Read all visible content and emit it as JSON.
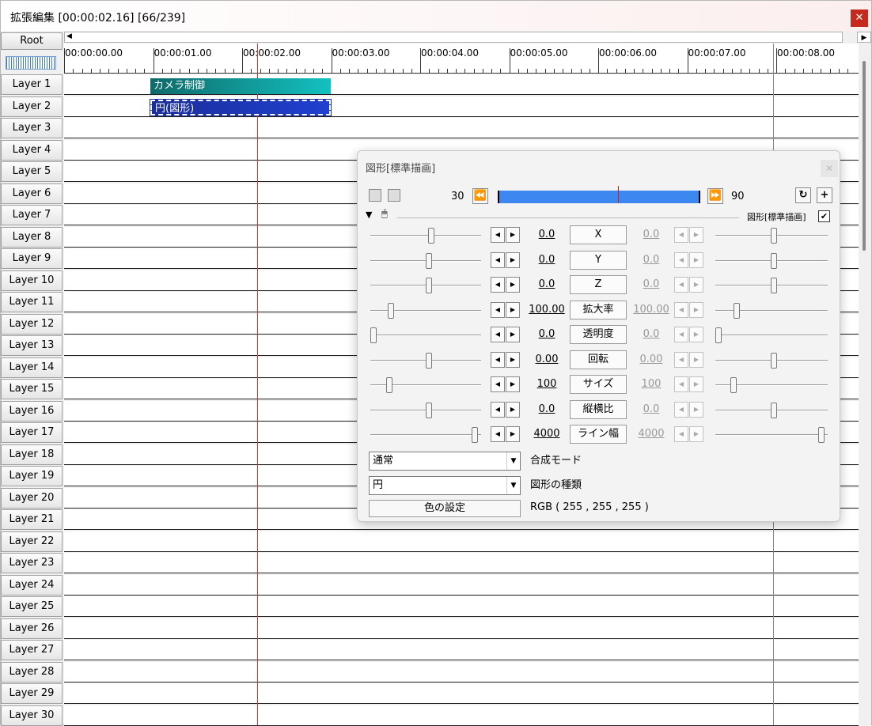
{
  "window": {
    "title": "拡張編集 [00:00:02.16] [66/239]",
    "close": "✕"
  },
  "timeline": {
    "root_label": "Root",
    "ruler": [
      "00:00:00.00",
      "00:00:01.00",
      "00:00:02.00",
      "00:00:03.00",
      "00:00:04.00",
      "00:00:05.00",
      "00:00:06.00",
      "00:00:07.00",
      "00:00:08.00"
    ],
    "layers": [
      "Layer 1",
      "Layer 2",
      "Layer 3",
      "Layer 4",
      "Layer 5",
      "Layer 6",
      "Layer 7",
      "Layer 8",
      "Layer 9",
      "Layer 10",
      "Layer 11",
      "Layer 12",
      "Layer 13",
      "Layer 14",
      "Layer 15",
      "Layer 16",
      "Layer 17",
      "Layer 18",
      "Layer 19",
      "Layer 20",
      "Layer 21",
      "Layer 22",
      "Layer 23",
      "Layer 24",
      "Layer 25",
      "Layer 26",
      "Layer 27",
      "Layer 28",
      "Layer 29",
      "Layer 30"
    ],
    "clips": {
      "camera": "カメラ制御",
      "circle": "円(図形)"
    },
    "colors": {
      "cursor": "#e03030",
      "camera_clip": "#14a8a8",
      "circle_clip": "#2038c0"
    }
  },
  "dialog": {
    "title": "図形[標準描画]",
    "close": "✕",
    "frame_start": "30",
    "frame_end": "90",
    "section_label": "図形[標準描画]",
    "check": "✔",
    "params": [
      {
        "label": "X",
        "left": "0.0",
        "right": "0.0",
        "lt": 0.55,
        "rt": 0.52
      },
      {
        "label": "Y",
        "left": "0.0",
        "right": "0.0",
        "lt": 0.53,
        "rt": 0.52
      },
      {
        "label": "Z",
        "left": "0.0",
        "right": "0.0",
        "lt": 0.53,
        "rt": 0.52
      },
      {
        "label": "拡大率",
        "left": "100.00",
        "right": "100.00",
        "lt": 0.17,
        "rt": 0.17
      },
      {
        "label": "透明度",
        "left": "0.0",
        "right": "0.0",
        "lt": 0.0,
        "rt": 0.0
      },
      {
        "label": "回転",
        "left": "0.00",
        "right": "0.00",
        "lt": 0.53,
        "rt": 0.52
      },
      {
        "label": "サイズ",
        "left": "100",
        "right": "100",
        "lt": 0.15,
        "rt": 0.14
      },
      {
        "label": "縦横比",
        "left": "0.0",
        "right": "0.0",
        "lt": 0.53,
        "rt": 0.52
      },
      {
        "label": "ライン幅",
        "left": "4000",
        "right": "4000",
        "lt": 0.97,
        "rt": 0.97
      }
    ],
    "blend_mode": {
      "value": "通常",
      "label": "合成モード"
    },
    "shape_type": {
      "value": "円",
      "label": "図形の種類"
    },
    "color_button": "色の設定",
    "rgb": "RGB ( 255 , 255 , 255 )"
  }
}
